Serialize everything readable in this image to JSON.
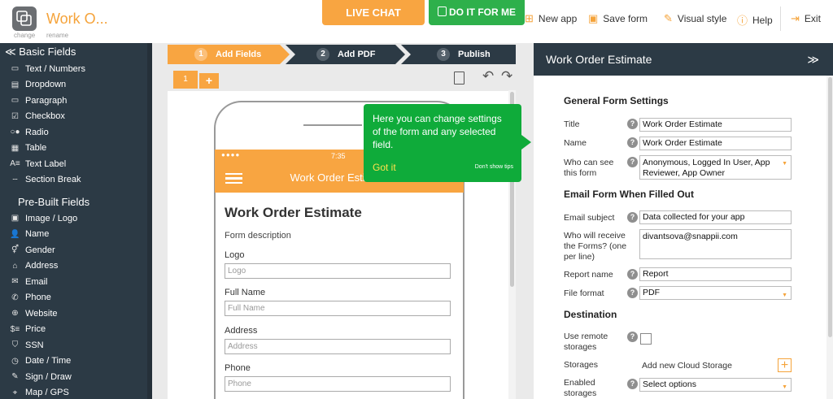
{
  "header": {
    "app_title": "Work O...",
    "change_label": "change",
    "rename_label": "rename",
    "live_chat": "LIVE CHAT",
    "do_it": "DO IT FOR ME",
    "menu": [
      {
        "label": "New app",
        "icon": "plus-square-icon"
      },
      {
        "label": "Save form",
        "icon": "save-icon"
      },
      {
        "label": "Visual style",
        "icon": "brush-icon"
      },
      {
        "label": "Help",
        "icon": "help-circle-icon"
      },
      {
        "label": "Exit",
        "icon": "exit-icon"
      }
    ]
  },
  "sidebar": {
    "basic_title": "Basic Fields",
    "basic_items": [
      {
        "label": "Text / Numbers",
        "icon": "▭"
      },
      {
        "label": "Dropdown",
        "icon": "▤"
      },
      {
        "label": "Paragraph",
        "icon": "▭"
      },
      {
        "label": "Checkbox",
        "icon": "☑"
      },
      {
        "label": "Radio",
        "icon": "○●"
      },
      {
        "label": "Table",
        "icon": "▦"
      },
      {
        "label": "Text Label",
        "icon": "A≡"
      },
      {
        "label": "Section Break",
        "icon": "┄"
      }
    ],
    "prebuilt_title": "Pre-Built Fields",
    "prebuilt_items": [
      {
        "label": "Image / Logo",
        "icon": "▣"
      },
      {
        "label": "Name",
        "icon": "👤"
      },
      {
        "label": "Gender",
        "icon": "⚥"
      },
      {
        "label": "Address",
        "icon": "⌂"
      },
      {
        "label": "Email",
        "icon": "✉"
      },
      {
        "label": "Phone",
        "icon": "✆"
      },
      {
        "label": "Website",
        "icon": "⊕"
      },
      {
        "label": "Price",
        "icon": "$≡"
      },
      {
        "label": "SSN",
        "icon": "⛉"
      },
      {
        "label": "Date / Time",
        "icon": "◷"
      },
      {
        "label": "Sign / Draw",
        "icon": "✎"
      },
      {
        "label": "Map / GPS",
        "icon": "⌖"
      }
    ]
  },
  "steps": [
    {
      "num": "1",
      "label": "Add Fields"
    },
    {
      "num": "2",
      "label": "Add PDF"
    },
    {
      "num": "3",
      "label": "Publish"
    }
  ],
  "page_tab": "1",
  "add_tab": "+",
  "phone": {
    "time": "7:35",
    "title": "Work Order Estimate",
    "heading": "Work Order Estimate",
    "description": "Form description",
    "fields": [
      {
        "label": "Logo",
        "placeholder": "Logo"
      },
      {
        "label": "Full Name",
        "placeholder": "Full Name"
      },
      {
        "label": "Address",
        "placeholder": "Address"
      },
      {
        "label": "Phone",
        "placeholder": "Phone"
      }
    ]
  },
  "tooltip": {
    "text": "Here you can change settings of the form and any selected field.",
    "got_it": "Got it",
    "dont_show": "Don't show tips"
  },
  "right_panel": {
    "title": "Work Order Estimate",
    "collapse": "≫",
    "general_title": "General Form Settings",
    "title_label": "Title",
    "title_value": "Work Order Estimate",
    "name_label": "Name",
    "name_value": "Work Order Estimate",
    "who_see_label": "Who can see this form",
    "who_see_value": "Anonymous, Logged In User, App Reviewer, App Owner",
    "email_title": "Email Form When Filled Out",
    "email_subject_label": "Email subject",
    "email_subject_value": "Data collected for your app",
    "receive_label": "Who will receive the Forms? (one per line)",
    "receive_value": "divantsova@snappii.com",
    "report_label": "Report name",
    "report_value": "Report",
    "format_label": "File format",
    "format_value": "PDF",
    "dest_title": "Destination",
    "remote_label": "Use remote storages",
    "storages_label": "Storages",
    "add_cloud": "Add new Cloud Storage",
    "enabled_label": "Enabled storages",
    "enabled_value": "Select options",
    "help_char": "?"
  }
}
